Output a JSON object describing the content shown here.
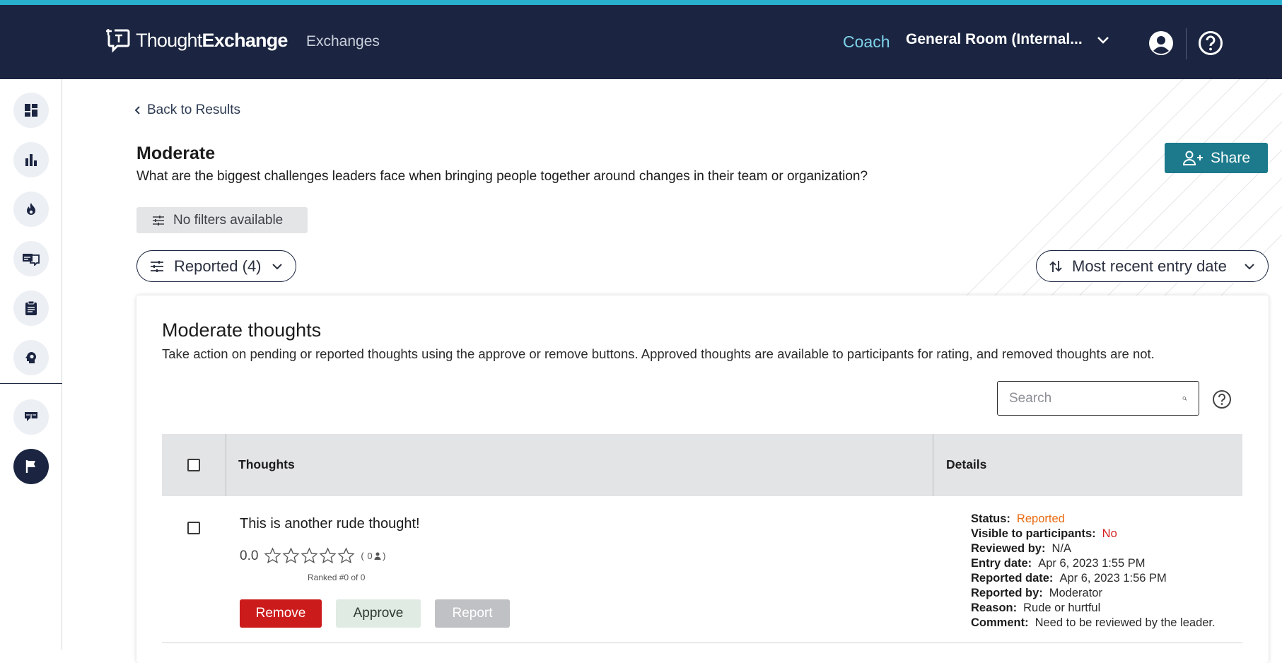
{
  "header": {
    "logo_thought": "Thought",
    "logo_exchange": "Exchange",
    "nav_exchanges": "Exchanges",
    "nav_coach": "Coach",
    "room_name": "General Room (Internal...",
    "accent_color": "#2ab0cf",
    "bg_color": "#1b2541"
  },
  "sidebar": {
    "items": [
      {
        "icon": "dashboard-icon"
      },
      {
        "icon": "bar-chart-icon"
      },
      {
        "icon": "fire-icon"
      },
      {
        "icon": "chat-board-icon"
      },
      {
        "icon": "clipboard-icon"
      },
      {
        "icon": "brain-head-icon"
      },
      {
        "icon": "discussion-icon"
      },
      {
        "icon": "flag-icon",
        "active": true
      }
    ]
  },
  "page": {
    "back_label": "Back to Results",
    "title": "Moderate",
    "question": "What are the biggest challenges leaders face when bringing people together around changes in their team or organization?",
    "share_label": "Share",
    "no_filters_label": "No filters available",
    "reported_filter_label": "Reported (4)",
    "sort_label": "Most recent entry date"
  },
  "card": {
    "title": "Moderate thoughts",
    "description": "Take action on pending or reported thoughts using the approve or remove buttons. Approved thoughts are available to participants for rating, and removed thoughts are not.",
    "search_placeholder": "Search",
    "columns": {
      "thoughts": "Thoughts",
      "details": "Details"
    },
    "rows": [
      {
        "text": "This is another rude thought!",
        "rating": "0.0",
        "stars_filled": 0,
        "votes": "( 0",
        "votes_close": ")",
        "rank": "Ranked #0 of 0",
        "remove_label": "Remove",
        "approve_label": "Approve",
        "report_label": "Report",
        "details": {
          "status_key": "Status:",
          "status_val": "Reported",
          "visible_key": "Visible to participants:",
          "visible_val": "No",
          "reviewed_key": "Reviewed by:",
          "reviewed_val": "N/A",
          "entry_key": "Entry date:",
          "entry_val": "Apr 6, 2023 1:55 PM",
          "reported_date_key": "Reported date:",
          "reported_date_val": "Apr 6, 2023 1:56 PM",
          "reported_by_key": "Reported by:",
          "reported_by_val": "Moderator",
          "reason_key": "Reason:",
          "reason_val": "Rude or hurtful",
          "comment_key": "Comment:",
          "comment_val": "Need to be reviewed by the leader."
        }
      }
    ]
  }
}
